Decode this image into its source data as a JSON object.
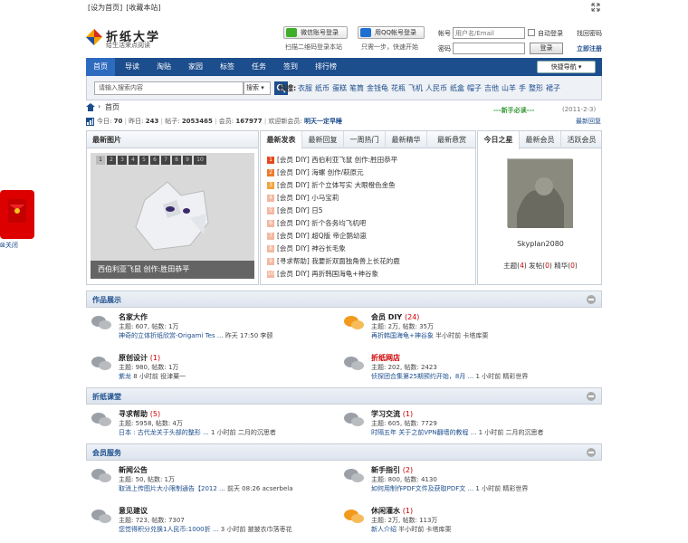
{
  "topbar": {
    "set_home": "[设为首页]",
    "bookmark": "[收藏本站]"
  },
  "logo": {
    "title": "折纸大学",
    "slogan": "给生活来点阅读"
  },
  "social": {
    "wechat_label": "微信账号登录",
    "qq_label": "用QQ帐号登录",
    "wechat_sub": "扫描二维码登录本站",
    "qq_sub": "只需一步，快速开始"
  },
  "login": {
    "account_label": "帐号",
    "account_placeholder": "用户名/Email",
    "password_label": "密码",
    "remember_label": "自动登录",
    "forgot_label": "找回密码",
    "register_label": "立即注册",
    "login_button": "登录"
  },
  "nav": {
    "items": [
      "首页",
      "导读",
      "淘贴",
      "家园",
      "标签",
      "任务",
      "签到",
      "排行榜"
    ],
    "quick_nav": "快捷导航"
  },
  "search": {
    "placeholder": "请输入搜索内容",
    "type": "搜索",
    "hot_label": "热搜:",
    "hot_terms": [
      "衣服",
      "纸币",
      "蛋糕",
      "笔筒",
      "金钱龟",
      "花瓶",
      "飞机",
      "人民币",
      "纸盒",
      "帽子",
      "吉他",
      "山羊",
      "手",
      "整形",
      "裙子"
    ]
  },
  "breadcrumb": {
    "home": "首页"
  },
  "stats": {
    "today_label": "今日:",
    "today": "70",
    "yesterday_label": "昨日:",
    "yesterday": "243",
    "posts_label": "帖子:",
    "posts": "2053465",
    "members_label": "会员:",
    "members": "167977",
    "welcome_label": "欢迎新会员:",
    "new_member": "明天一定早睡",
    "notice": "新手必读",
    "notice_date": "(2011-2-3)",
    "latest_reply": "最新回复"
  },
  "images_panel": {
    "title": "最新图片",
    "pages": [
      "1",
      "2",
      "3",
      "4",
      "5",
      "6",
      "7",
      "8",
      "9",
      "10"
    ],
    "caption": "西伯利亚飞鼠 创作:胜田恭平"
  },
  "posts_panel": {
    "tabs": [
      "最新发表",
      "最新回复",
      "一周热门",
      "最新精华",
      "最新悬赏"
    ],
    "rows": [
      {
        "num": "1",
        "text": "[会员 DIY] 西伯利亚飞鼠 创作:胜田恭平"
      },
      {
        "num": "2",
        "text": "[会员 DIY] 海螺 创作/萩原元"
      },
      {
        "num": "3",
        "text": "[会员 DIY] 折个立体写实 大眼橙色金鱼"
      },
      {
        "num": "4",
        "text": "[会员 DIY] 小马宝莉"
      },
      {
        "num": "5",
        "text": "[会员 DIY] 日5"
      },
      {
        "num": "6",
        "text": "[会员 DIY] 折个各务均飞机吧"
      },
      {
        "num": "7",
        "text": "[会员 DIY] 超Q版 帝企鹅幼崽"
      },
      {
        "num": "8",
        "text": "[会员 DIY] 神谷长毛象"
      },
      {
        "num": "9",
        "text": "[寻求帮助] 我要折双面独角兽上长花的鹿"
      },
      {
        "num": "10",
        "text": "[会员 DIY] 再折韩国海龟+神谷象"
      }
    ]
  },
  "star_panel": {
    "tabs": [
      "今日之星",
      "最新会员",
      "活跃会员"
    ],
    "username": "Skyplan2080",
    "topics_label": "主题",
    "topics": "4",
    "posts_label": "发帖",
    "posts": "0",
    "digest_label": "精华",
    "digest": "0"
  },
  "sections": [
    {
      "title": "作品展示",
      "forums": [
        {
          "name": "名家大作",
          "today": "",
          "stats": "主题: 607, 帖数: 1万",
          "last_title": "神奇的立体折纸欣赏-Origami Tes ...",
          "last_meta": "昨天 17:50 李颐"
        },
        {
          "name": "会员 DIY",
          "today": "(24)",
          "stats": "主题: 2万, 帖数: 35万",
          "last_title": "再折韩国海龟+神谷象",
          "last_meta": "半小时前 卡塔库栗"
        },
        {
          "name": "原创设计",
          "today": "(1)",
          "stats": "主题: 980, 帖数: 1万",
          "last_title": "紫龙",
          "last_meta": "8 小时前 役津粟一"
        },
        {
          "name": "折纸网店",
          "today": "",
          "stats": "主题: 202, 帖数: 2423",
          "last_title": "侦探团合集第25期预约开始，8月 ...",
          "last_meta": "1 小时前 精彩世界"
        }
      ]
    },
    {
      "title": "折纸课堂",
      "forums": [
        {
          "name": "寻求帮助",
          "today": "(5)",
          "stats": "主题: 5958, 帖数: 4万",
          "last_title": "日本 : 古代龙关于头部的整形 ...",
          "last_meta": "1 小时前 二月的沉思者"
        },
        {
          "name": "学习交流",
          "today": "(1)",
          "stats": "主题: 605, 帖数: 7729",
          "last_title": "时隔五年 关于之前VPN翻墙的教程 ...",
          "last_meta": "1 小时前 二月的沉思者"
        }
      ]
    },
    {
      "title": "会员服务",
      "forums": [
        {
          "name": "新闻公告",
          "today": "",
          "stats": "主题: 50, 帖数: 1万",
          "last_title": "取消上传图片大小限制通告【2012 ...",
          "last_meta": "前天 08:26 acserbela"
        },
        {
          "name": "新手指引",
          "today": "(2)",
          "stats": "主题: 800, 帖数: 4130",
          "last_title": "如何用制作PDF文件及获取PDF文 ...",
          "last_meta": "1 小时前 精彩世界"
        },
        {
          "name": "意见建议",
          "today": "",
          "stats": "主题: 723, 帖数: 7307",
          "last_title": "您觉得积分兑换1人民币:1000折 ...",
          "last_meta": "3 小时前 披披衣巾落枣花"
        },
        {
          "name": "休闲灌水",
          "today": "(1)",
          "stats": "主题: 2万, 帖数: 113万",
          "last_title": "新人介绍",
          "last_meta": "半小时前 卡塔库栗"
        }
      ]
    }
  ],
  "side_badge": {
    "close": "关闭"
  },
  "colors": {
    "nav": "#1c4d8d",
    "nav_active": "#2d6bbf",
    "link": "#1c4d8d",
    "badge": "#dd0000"
  }
}
